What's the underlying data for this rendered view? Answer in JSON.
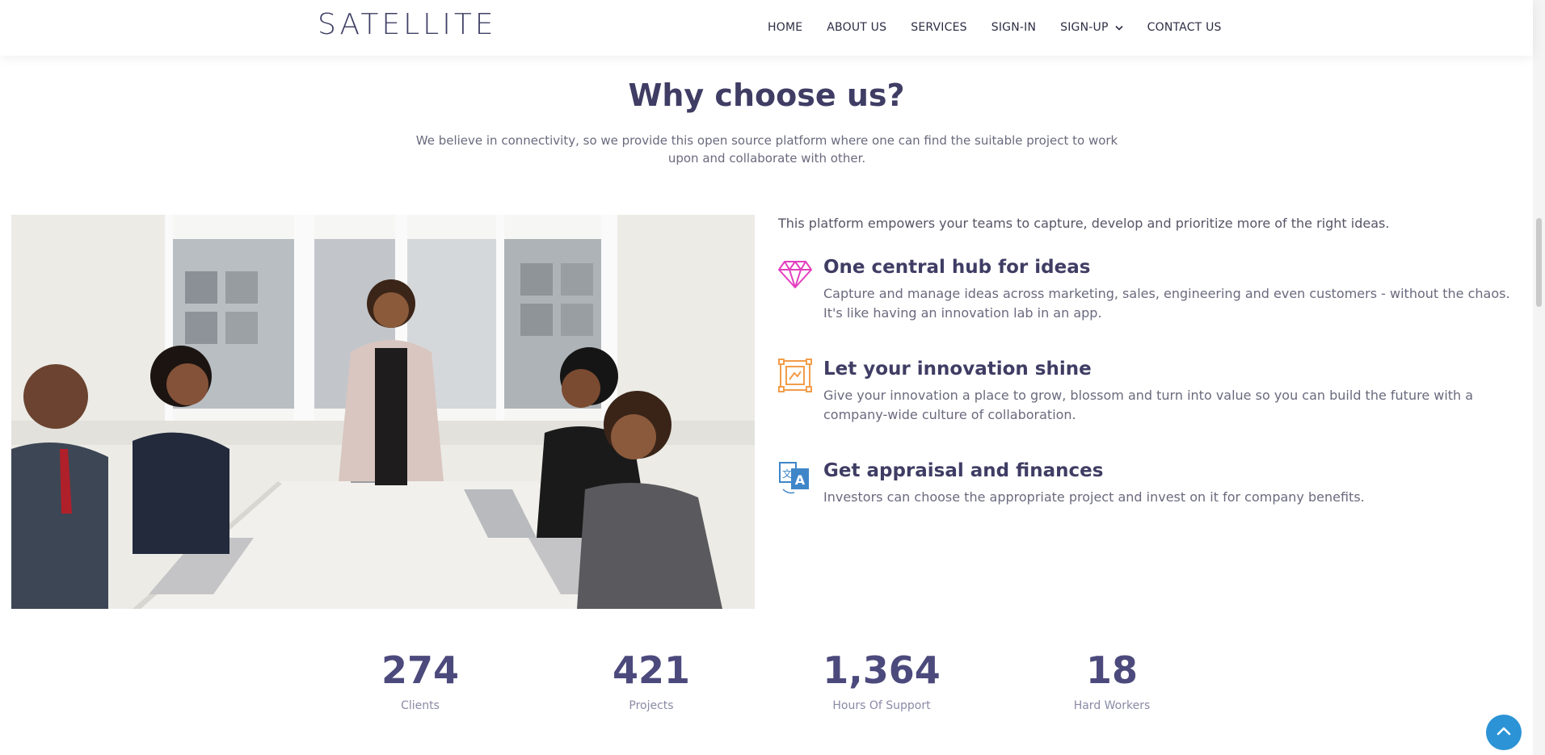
{
  "header": {
    "logo": "SATELLITE",
    "nav": [
      {
        "label": "HOME"
      },
      {
        "label": "ABOUT US"
      },
      {
        "label": "SERVICES"
      },
      {
        "label": "SIGN-IN"
      },
      {
        "label": "SIGN-UP",
        "icon": "chevron-down-icon"
      },
      {
        "label": "CONTACT US"
      }
    ]
  },
  "why": {
    "title": "Why choose us?",
    "subtitle": "We believe in connectivity, so we provide this open source platform where one can find the suitable project to work upon and collaborate with other."
  },
  "features": {
    "intro": "This platform empowers your teams to capture, develop and prioritize more of the right ideas.",
    "items": [
      {
        "icon": "diamond-icon",
        "color": "#e43fbf",
        "title": "One central hub for ideas",
        "description": "Capture and manage ideas across marketing, sales, engineering and even customers - without the chaos. It's like having an innovation lab in an app."
      },
      {
        "icon": "frame-icon",
        "color": "#f29d4a",
        "title": "Let your innovation shine",
        "description": "Give your innovation a place to grow, blossom and turn into value so you can build the future with a company-wide culture of collaboration."
      },
      {
        "icon": "translate-icon",
        "color": "#3f86c9",
        "title": "Get appraisal and finances",
        "description": "Investors can choose the appropriate project and invest on it for company benefits."
      }
    ]
  },
  "counters": [
    {
      "value": "274",
      "label": "Clients"
    },
    {
      "value": "421",
      "label": "Projects"
    },
    {
      "value": "1,364",
      "label": "Hours Of Support"
    },
    {
      "value": "18",
      "label": "Hard Workers"
    }
  ],
  "colors": {
    "heading": "#3f3d64",
    "counter": "#4c4a7c",
    "back_to_top": "#2b93d6"
  },
  "back_to_top": {
    "icon": "chevron-up-icon"
  }
}
